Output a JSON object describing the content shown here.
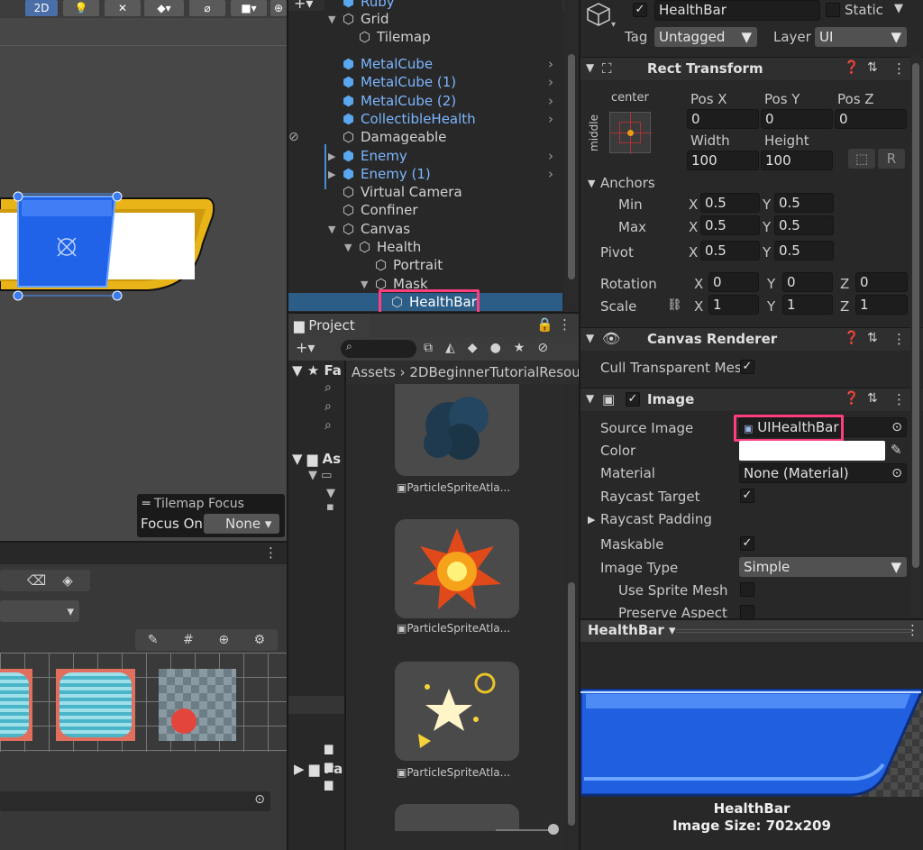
{
  "scene": {
    "mode_2d": "2D",
    "tilemap_focus_title": "Tilemap Focus",
    "focus_on_label": "Focus On",
    "focus_on_value": "None"
  },
  "hierarchy": {
    "items": [
      {
        "label": "Ruby",
        "blue": true
      },
      {
        "label": "Grid"
      },
      {
        "label": "Tilemap"
      },
      {
        "label": "MetalCube",
        "blue": true
      },
      {
        "label": "MetalCube (1)",
        "blue": true
      },
      {
        "label": "MetalCube (2)",
        "blue": true
      },
      {
        "label": "CollectibleHealth",
        "blue": true
      },
      {
        "label": "Damageable"
      },
      {
        "label": "Enemy",
        "blue": true
      },
      {
        "label": "Enemy (1)",
        "blue": true
      },
      {
        "label": "Virtual Camera"
      },
      {
        "label": "Confiner"
      },
      {
        "label": "Canvas"
      },
      {
        "label": "Health"
      },
      {
        "label": "Portrait"
      },
      {
        "label": "Mask"
      },
      {
        "label": "HealthBar",
        "selected": true
      }
    ]
  },
  "project": {
    "tab": "Project",
    "breadcrumb_root": "Assets",
    "breadcrumb_folder": "2DBeginnerTutorialResou",
    "tree_fa": "Fa",
    "tree_as": "As",
    "tree_pa": "Pa",
    "asset_label": "ParticleSpriteAtla..."
  },
  "inspector": {
    "object_name": "HealthBar",
    "static_label": "Static",
    "tag_label": "Tag",
    "tag_value": "Untagged",
    "layer_label": "Layer",
    "layer_value": "UI",
    "rect_transform": {
      "title": "Rect Transform",
      "anchor_h": "center",
      "anchor_v": "middle",
      "pos_x_label": "Pos X",
      "pos_y_label": "Pos Y",
      "pos_z_label": "Pos Z",
      "pos_x": "0",
      "pos_y": "0",
      "pos_z": "0",
      "width_label": "Width",
      "height_label": "Height",
      "width": "100",
      "height": "100",
      "r_btn": "R",
      "anchors_label": "Anchors",
      "min_label": "Min",
      "max_label": "Max",
      "min_x": "0.5",
      "min_y": "0.5",
      "max_x": "0.5",
      "max_y": "0.5",
      "pivot_label": "Pivot",
      "pivot_x": "0.5",
      "pivot_y": "0.5",
      "rotation_label": "Rotation",
      "rot_x": "0",
      "rot_y": "0",
      "rot_z": "0",
      "scale_label": "Scale",
      "scale_x": "1",
      "scale_y": "1",
      "scale_z": "1",
      "x": "X",
      "y": "Y",
      "z": "Z"
    },
    "canvas_renderer": {
      "title": "Canvas Renderer",
      "cull_label": "Cull Transparent Mes"
    },
    "image": {
      "title": "Image",
      "source_image_label": "Source Image",
      "source_image_value": "UIHealthBar",
      "color_label": "Color",
      "material_label": "Material",
      "material_value": "None (Material)",
      "raycast_target_label": "Raycast Target",
      "raycast_padding_label": "Raycast Padding",
      "maskable_label": "Maskable",
      "image_type_label": "Image Type",
      "image_type_value": "Simple",
      "use_sprite_mesh_label": "Use Sprite Mesh",
      "preserve_aspect_label": "Preserve Aspect"
    }
  },
  "preview": {
    "header": "HealthBar",
    "name": "HealthBar",
    "size": "Image Size: 702x209"
  },
  "colors": {
    "selection": "#2c5d87",
    "highlight": "#ff3d7f",
    "prefab_blue": "#7cb6ff",
    "bar_blue": "#1f5fe0"
  }
}
